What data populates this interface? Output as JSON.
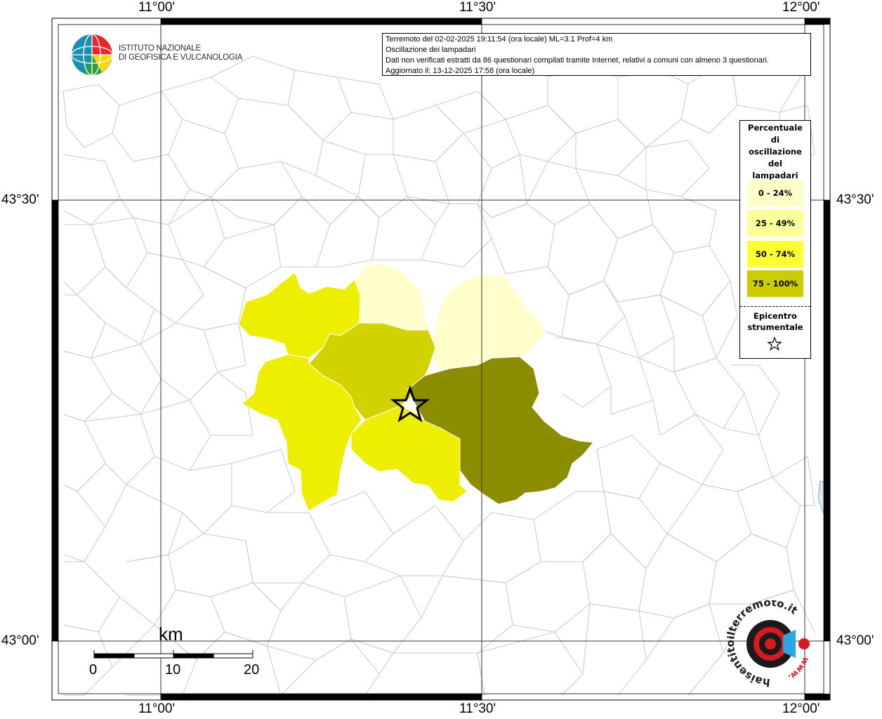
{
  "map": {
    "grid_labels": {
      "lon": [
        "11°00'",
        "11°30'",
        "12°00'"
      ],
      "lat": [
        "43°30'",
        "43°00'"
      ]
    }
  },
  "logo": {
    "line1": "ISTITUTO NAZIONALE",
    "line2": "DI GEOFISICA E VULCANOLOGIA"
  },
  "info": {
    "line1": "Terremoto del 02-02-2025 19:11:54 (ora locale) ML=3.1 Prof=4 km",
    "line2": "Oscillazione dei lampadari",
    "line3": "Dati non verificati estratti da 86 questionari compilati tramite Internet, relativi a comuni con almeno 3 questionari.",
    "line4": "Aggiornato il: 13-12-2025 17:58 (ora locale)"
  },
  "legend": {
    "title": [
      "Percentuale",
      "di",
      "oscillazione",
      "del",
      "lampadari"
    ],
    "classes": [
      {
        "label": "0 - 24%",
        "color": "#ffffcc"
      },
      {
        "label": "25 - 49%",
        "color": "#ffff99"
      },
      {
        "label": "50 - 74%",
        "color": "#ffff33"
      },
      {
        "label": "75 - 100%",
        "color": "#cccc00"
      }
    ],
    "epicenter_label": [
      "Epicentro",
      "strumentale"
    ]
  },
  "scale": {
    "unit": "km",
    "ticks": [
      "0",
      "10",
      "20"
    ]
  },
  "colors": {
    "class_0_24": "#ffffcc",
    "class_25_49": "#ffff99",
    "class_50_74": "#eeee00",
    "class_75_100": "#d2d200",
    "class_top_fill": "#8c8c00",
    "boundary": "#bdbdbd"
  },
  "hst_logo": {
    "text": "haisentitoilterremoto.it",
    "url_text": "www."
  }
}
